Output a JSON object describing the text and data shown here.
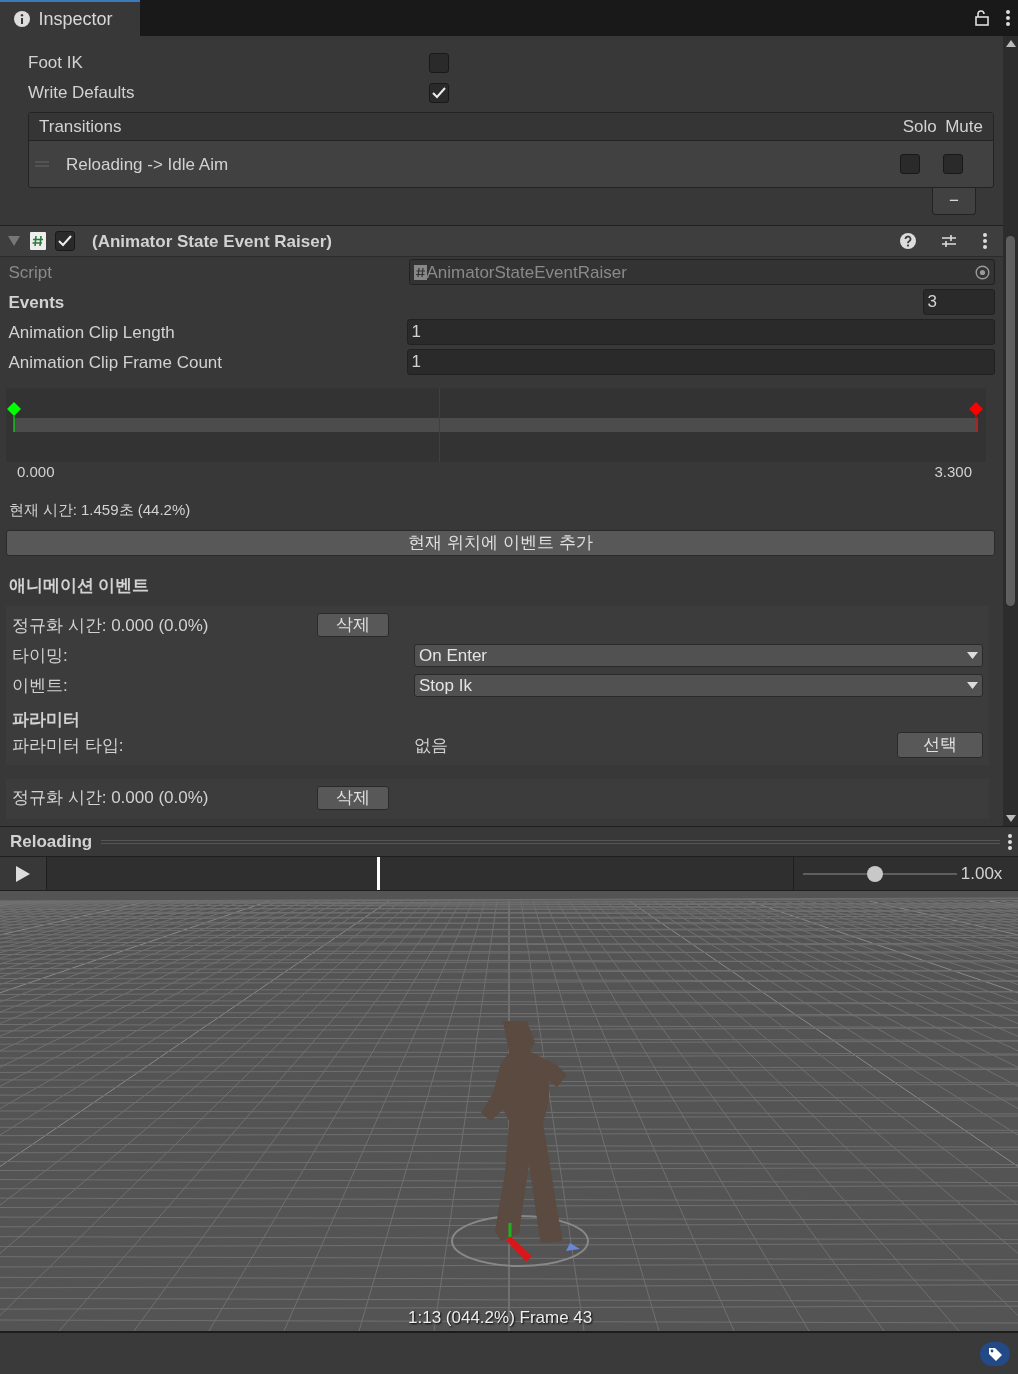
{
  "tab": {
    "label": "Inspector",
    "selected": true
  },
  "state_settings": [
    {
      "label": "Foot IK",
      "checked": false
    },
    {
      "label": "Write Defaults",
      "checked": true
    }
  ],
  "transitions": {
    "title": "Transitions",
    "solo_header": "Solo",
    "mute_header": "Mute",
    "rows": [
      {
        "label": "Reloading -> Idle Aim",
        "solo": false,
        "mute": false
      }
    ],
    "remove_button": "−"
  },
  "component": {
    "expanded": true,
    "enabled": true,
    "title": "(Animator State Event Raiser)",
    "script_label": "Script",
    "script_value": "AnimatorStateEventRaiser",
    "events_label": "Events",
    "events_count": "3",
    "fields": [
      {
        "label": "Animation Clip Length",
        "value": "1"
      },
      {
        "label": "Animation Clip Frame Count",
        "value": "1"
      }
    ],
    "timeline": {
      "start_label": "0.000",
      "end_label": "3.300",
      "playhead": {
        "level": 0.442
      },
      "markers": [
        {
          "level": 0,
          "color": "#00ff00"
        },
        {
          "level": 1,
          "color": "#ff0000"
        }
      ]
    },
    "current_time": "현재 시간: 1.459초 (44.2%)",
    "add_button": "현재 위치에 이벤트 추가",
    "section_title": "애니메이션 이벤트",
    "events": [
      {
        "time": "정규화 시간: 0.000 (0.0%)",
        "delete": "삭제",
        "timing_label": "타이밍:",
        "timing": "On Enter",
        "event_label": "이벤트:",
        "event": "Stop Ik",
        "param_title": "파라미터",
        "param_type_label": "파라미터 타입:",
        "param_type": "없음",
        "select": "선택"
      },
      {
        "time": "정규화 시간: 0.000 (0.0%)",
        "delete": "삭제"
      }
    ]
  },
  "preview": {
    "title": "Reloading",
    "scrubber": {
      "level": 0.443
    },
    "speed_slider": {
      "level": 0.47
    },
    "speed": "1.00x",
    "overlay": "1:13 (044.2%) Frame 43"
  }
}
